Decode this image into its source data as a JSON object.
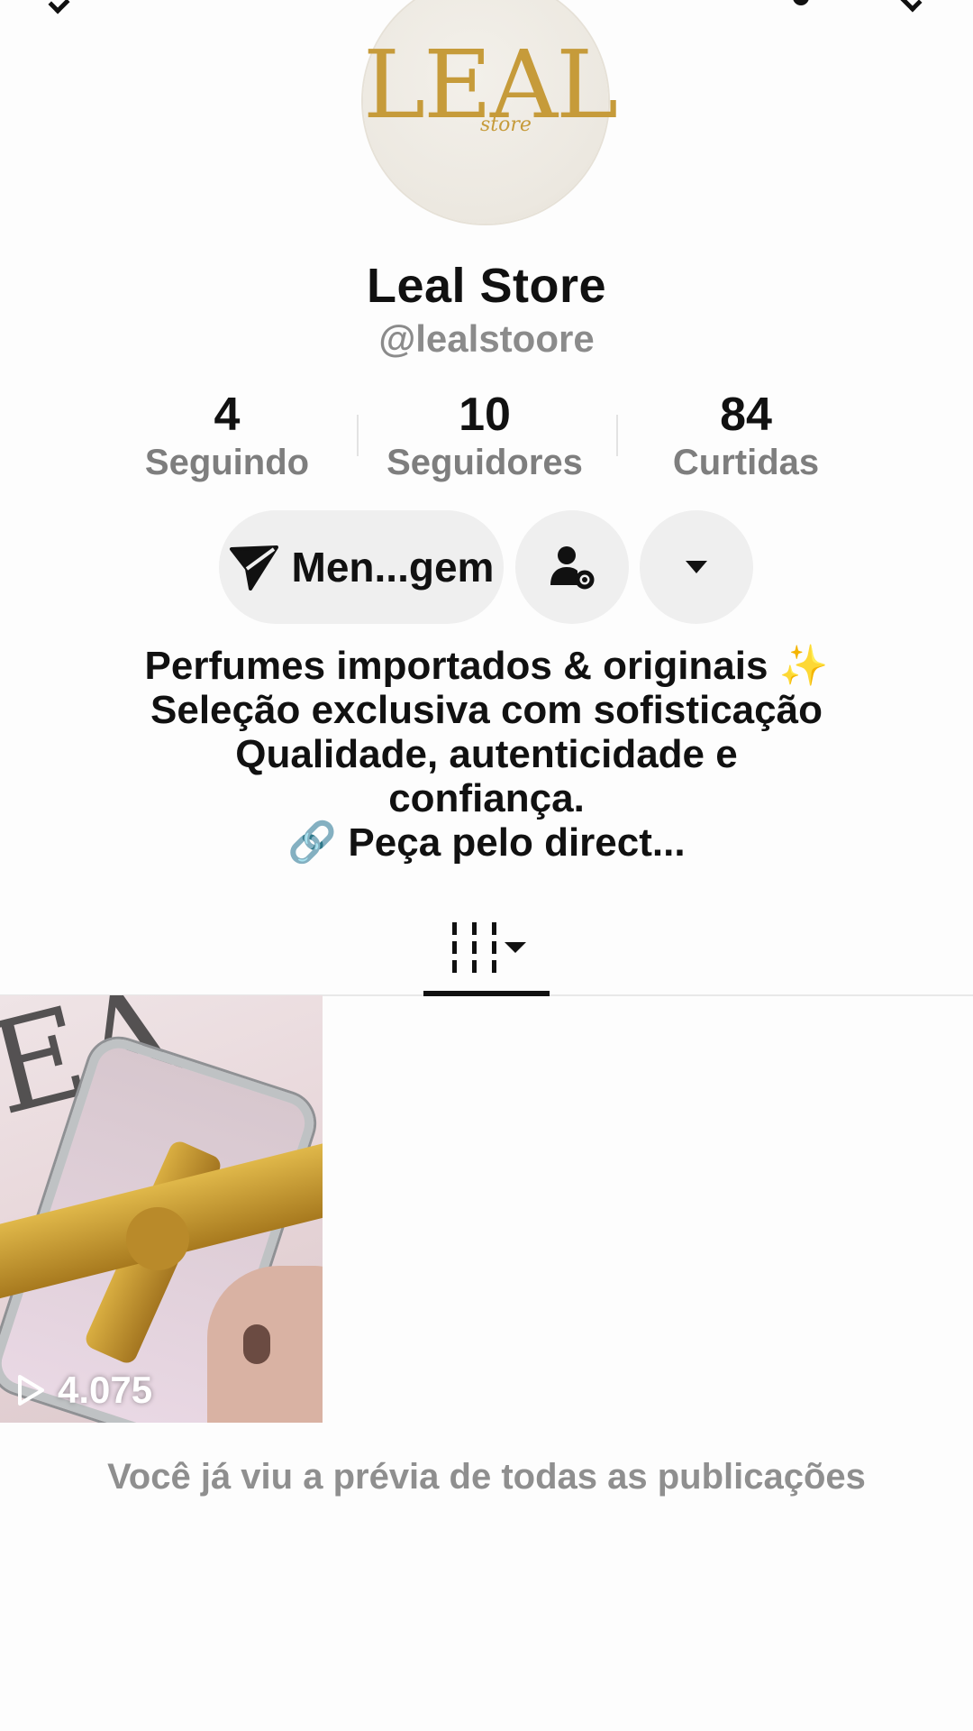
{
  "profile": {
    "avatar_logo": "LEAL",
    "avatar_logo_sub": "store",
    "display_name": "Leal Store",
    "handle": "@lealstoore"
  },
  "stats": [
    {
      "value": "4",
      "label": "Seguindo"
    },
    {
      "value": "10",
      "label": "Seguidores"
    },
    {
      "value": "84",
      "label": "Curtidas"
    }
  ],
  "actions": {
    "message_label": "Men...gem",
    "add_friend_icon": "person-gear-icon",
    "more_icon": "caret-down-icon"
  },
  "bio": {
    "lines": [
      "Perfumes importados & originais ✨",
      "Seleção exclusiva com sofisticação",
      "Qualidade, autenticidade e",
      "confiança.",
      "🔗 Peça pelo direct..."
    ]
  },
  "tabs": {
    "active_icon": "grid-icon"
  },
  "videos": [
    {
      "views": "4.075"
    }
  ],
  "end_message": "Você já viu a prévia de todas as publicações",
  "colors": {
    "background": "#fdfdfd",
    "secondary_text": "#8b8b8b",
    "button_bg": "#efefef",
    "gold": "#c69b3a"
  }
}
